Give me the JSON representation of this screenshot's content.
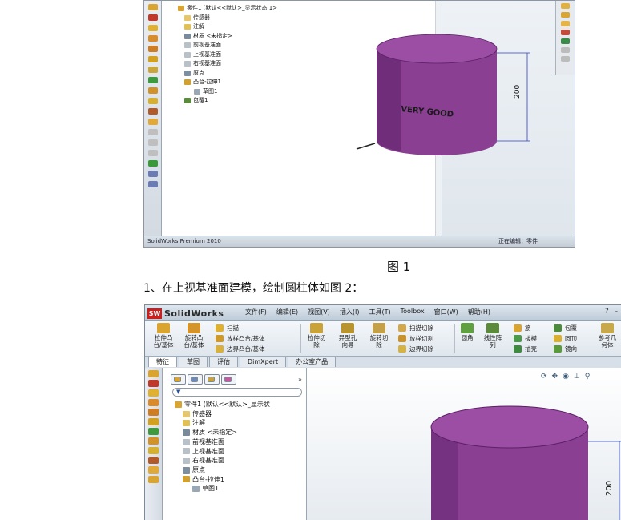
{
  "figure1": {
    "status_left": "SolidWorks Premium 2010",
    "status_right": "正在编辑：零件",
    "tree": [
      "零件1 (默认<<默认>_显示状态 1>",
      "传感器",
      "注解",
      "材质 <未指定>",
      "前视基准面",
      "上视基准面",
      "右视基准面",
      "原点",
      "凸台-拉伸1",
      "草图1",
      "包覆1"
    ],
    "cylinder_text": "VERY GOOD",
    "dimension": "200",
    "caption": "图 1"
  },
  "step_text": "1、在上视基准面建模，绘制圆柱体如图 2：",
  "figure2": {
    "app_name": "SolidWorks",
    "app_badge": "SW",
    "menu": [
      "文件(F)",
      "编辑(E)",
      "视图(V)",
      "插入(I)",
      "工具(T)",
      "Toolbox",
      "窗口(W)",
      "帮助(H)"
    ],
    "window_controls": [
      "?",
      "-"
    ],
    "ribbon": {
      "extrude_boss": "拉伸凸\n台/基体",
      "revolve_boss": "旋转凸\n台/基体",
      "sweep": "扫描",
      "loft": "放样凸台/基体",
      "boundary": "边界凸台/基体",
      "extrude_cut": "拉伸切\n除",
      "hole_wizard": "异型孔\n向导",
      "revolve_cut": "旋转切\n除",
      "sweep_cut": "扫描切除",
      "loft_cut": "放样切割",
      "boundary_cut": "边界切除",
      "fillet": "圆角",
      "linear_pattern": "线性阵\n列",
      "rib": "筋",
      "draft": "拔模",
      "shell": "抽壳",
      "wrap": "包覆",
      "dome": "圆顶",
      "mirror": "镜向",
      "ref_geometry": "参考几\n何体"
    },
    "tabs": [
      "特征",
      "草图",
      "评估",
      "DimXpert",
      "办公室产品"
    ],
    "panel_more": "»",
    "tree": [
      "零件1 (默认<<默认>_显示状",
      "传感器",
      "注解",
      "材质 <未指定>",
      "前视基准面",
      "上视基准面",
      "右视基准面",
      "原点",
      "凸台-拉伸1",
      "草图1"
    ],
    "dimension": "200"
  },
  "colors": {
    "cylinder_side": "#8a3f93",
    "cylinder_top": "#9b4ea3",
    "dimension_line": "#2d3fc4"
  }
}
